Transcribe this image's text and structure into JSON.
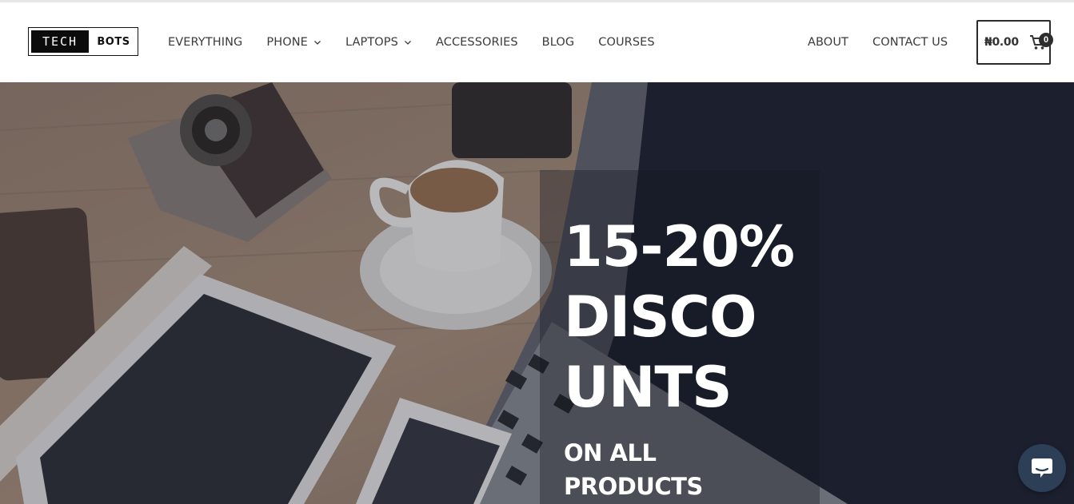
{
  "brand": {
    "logo_left": "TECH",
    "logo_right": "BOTS"
  },
  "nav": {
    "items": [
      {
        "label": "EVERYTHING",
        "has_dropdown": false
      },
      {
        "label": "PHONE",
        "has_dropdown": true
      },
      {
        "label": "LAPTOPS",
        "has_dropdown": true
      },
      {
        "label": "ACCESSORIES",
        "has_dropdown": false
      },
      {
        "label": "BLOG",
        "has_dropdown": false
      },
      {
        "label": "COURSES",
        "has_dropdown": false
      }
    ],
    "right_items": [
      {
        "label": "ABOUT"
      },
      {
        "label": "CONTACT US"
      }
    ]
  },
  "cart": {
    "total": "₦0.00",
    "count": "0",
    "icon": "shopping-cart-icon"
  },
  "hero": {
    "title": "15-20%\nDISCO\nUNTS",
    "subtitle": "ON ALL\nPRODUCTS"
  },
  "chat": {
    "icon": "chat-bubble-icon",
    "color": "#2d3e57"
  },
  "colors": {
    "text": "#3a3a3a",
    "hero_text": "#ffffff"
  }
}
